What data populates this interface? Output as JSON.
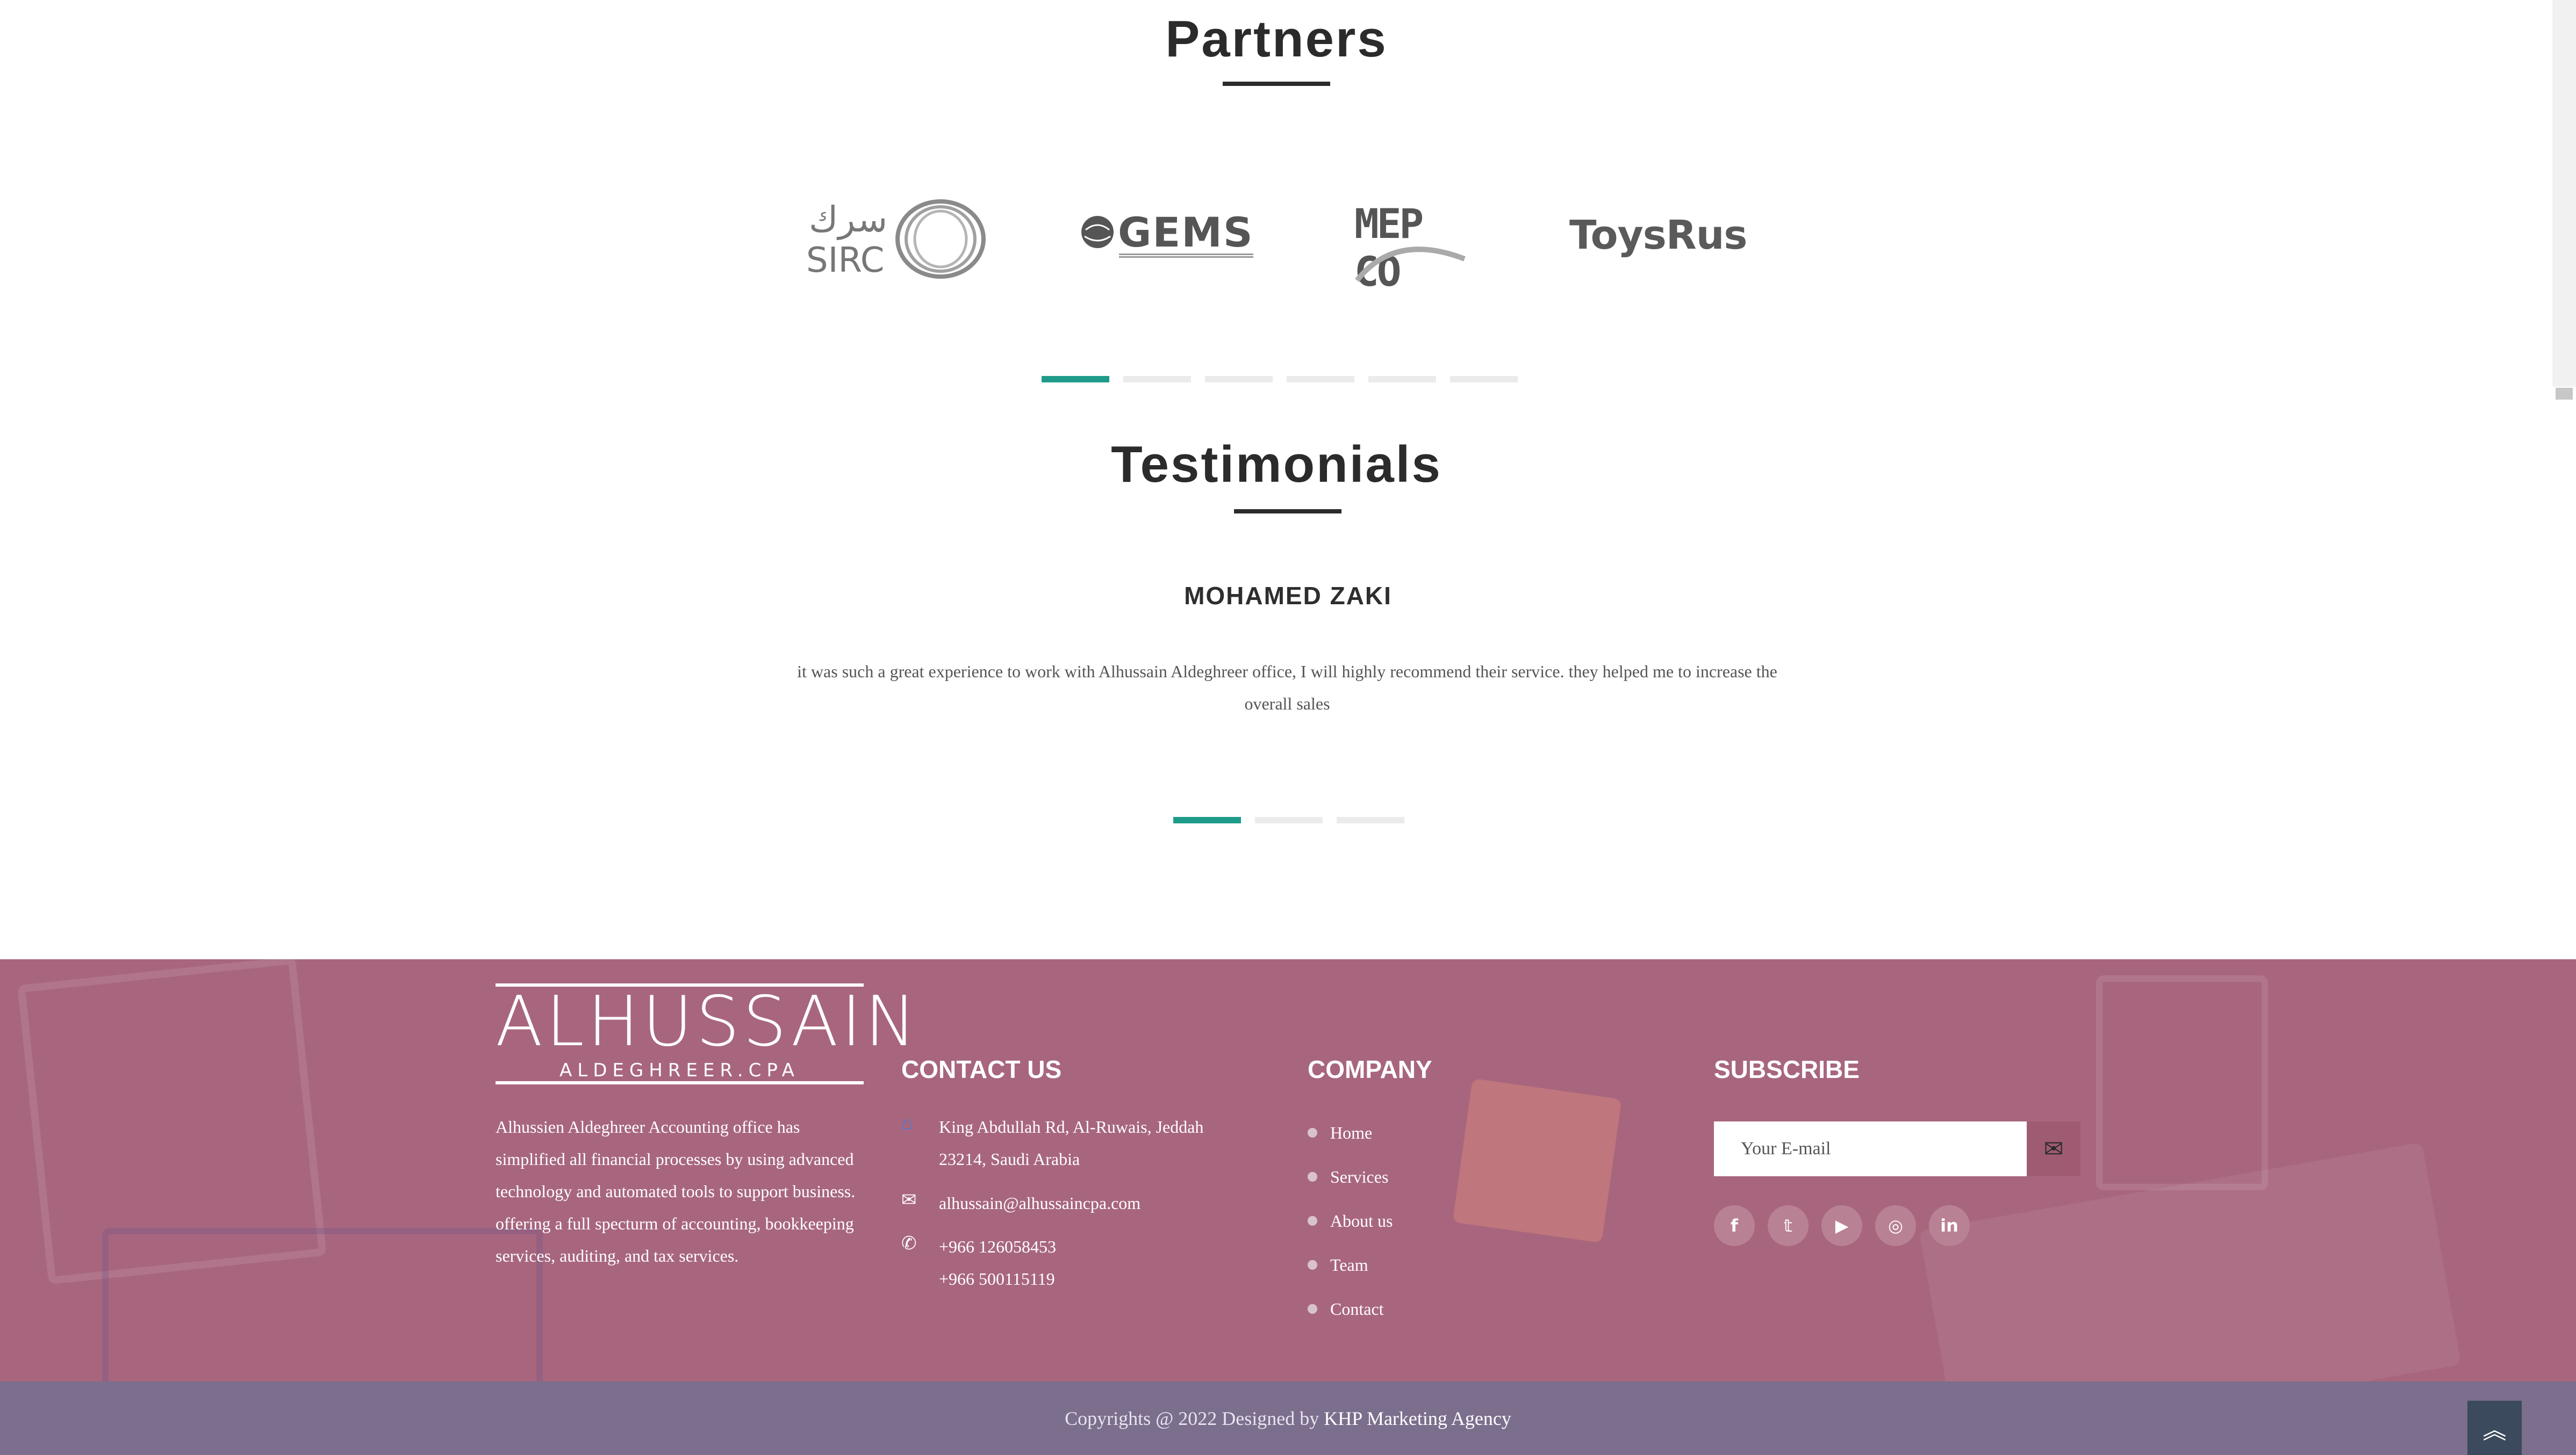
{
  "partners": {
    "title": "Partners",
    "logos": [
      {
        "name": "sirc-logo",
        "arabic": "سرك",
        "text": "SIRC"
      },
      {
        "name": "gems-logo",
        "text": "GEMS"
      },
      {
        "name": "mepco-logo",
        "text": "MEP CO"
      },
      {
        "name": "toysrus-logo",
        "text": "ToysRus"
      }
    ]
  },
  "testimonials": {
    "title": "Testimonials",
    "name": "MOHAMED ZAKI",
    "text": "it was such a great experience to work with Alhussain Aldeghreer office, I will highly recommend their service. they helped me to increase the overall sales"
  },
  "footer": {
    "brand_name": "ALHUSSAIN",
    "brand_sub": "ALDEGHREER.CPA",
    "about": "Alhussien Aldeghreer Accounting office has simplified all financial processes by using advanced technology and automated tools to support business. offering a full specturm of accounting, bookkeeping services, auditing, and tax services.",
    "contact": {
      "title": "CONTACT US",
      "address": "King Abdullah Rd, Al-Ruwais, Jeddah 23214, Saudi Arabia",
      "email": "alhussain@alhussaincpa.com",
      "phone1": "+966 126058453",
      "phone2": "+966 500115119"
    },
    "company": {
      "title": "COMPANY",
      "items": [
        "Home",
        "Services",
        "About us",
        "Team",
        "Contact"
      ]
    },
    "subscribe": {
      "title": "SUBSCRIBE",
      "placeholder": "Your E-mail"
    },
    "social": [
      "facebook-icon",
      "twitter-icon",
      "youtube-icon",
      "instagram-icon",
      "linkedin-icon"
    ],
    "copyright_prefix": "Copyrights @ 2022 Designed by ",
    "agency": "KHP Marketing Agency"
  },
  "colors": {
    "accent": "#1f9b8a",
    "footer_bg": "#a8667e",
    "bottom_bar": "#7c6e8d"
  }
}
